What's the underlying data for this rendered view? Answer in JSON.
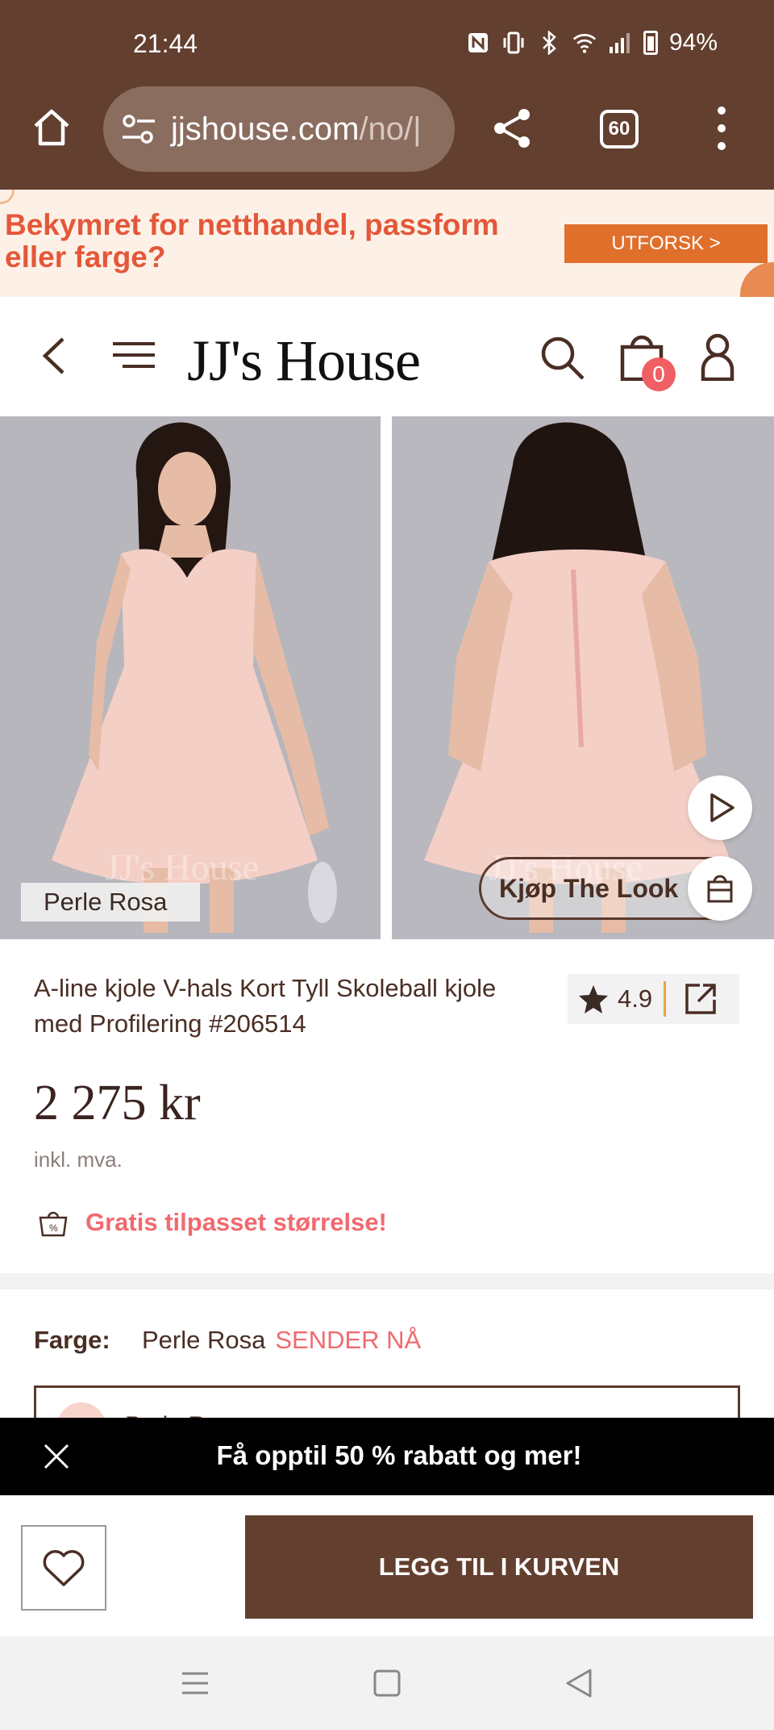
{
  "status_bar": {
    "time": "21:44",
    "battery": "94%",
    "icons": [
      "nfc-icon",
      "vibrate-icon",
      "bluetooth-icon",
      "wifi-icon",
      "signal-icon",
      "battery-icon"
    ]
  },
  "browser": {
    "url_main": "jjshouse.com",
    "url_path": "/no/|",
    "tab_count": "60"
  },
  "promo_banner": {
    "text": "Bekymret for netthandel, passform eller farge?",
    "cta": "UTFORSK >"
  },
  "site_header": {
    "logo": "JJ's House",
    "cart_count": "0"
  },
  "gallery": {
    "watermark": "JJ's House",
    "color_tag": "Perle Rosa",
    "shop_the_look": "Kjøp The Look"
  },
  "product": {
    "title": "A-line kjole V-hals Kort Tyll Skoleball kjole med Profilering #206514",
    "rating": "4.9",
    "price": "2 275 kr",
    "vat_note": "inkl. mva.",
    "free_size": "Gratis tilpasset størrelse!",
    "color_label": "Farge:",
    "color_value": "Perle Rosa",
    "shipping_note": "SENDER NÅ",
    "swatch_name": "Perle Rosa"
  },
  "deal_bar": {
    "text": "Få opptil 50 % rabatt og mer!"
  },
  "actions": {
    "add_to_cart": "LEGG TIL I KURVEN"
  },
  "colors": {
    "chrome": "#633f2f",
    "accent": "#f06a6f",
    "promo_orange": "#e4573a"
  }
}
